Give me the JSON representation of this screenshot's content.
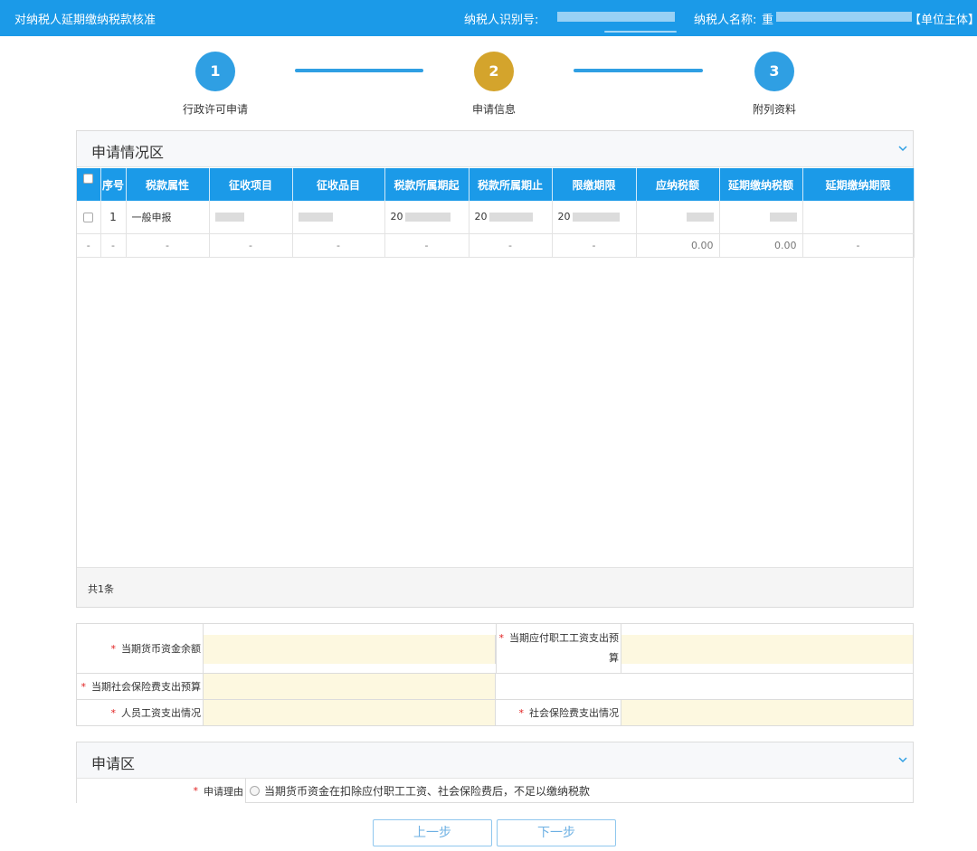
{
  "topbar": {
    "title": "对纳税人延期缴纳税款核准",
    "tin_label": "纳税人识别号:",
    "name_label": "纳税人名称:",
    "name_prefix": "重",
    "entity_tag": "【单位主体】"
  },
  "steps": [
    {
      "number": "1",
      "label": "行政许可申请"
    },
    {
      "number": "2",
      "label": "申请信息"
    },
    {
      "number": "3",
      "label": "附列资料"
    }
  ],
  "apply_status": {
    "title": "申请情况区",
    "columns": [
      "序号",
      "税款属性",
      "征收项目",
      "征收品目",
      "税款所属期起",
      "税款所属期止",
      "限缴期限",
      "应纳税额",
      "延期缴纳税额",
      "延期缴纳期限"
    ],
    "rows": [
      {
        "index": "1",
        "attr": "一般申报",
        "start_prefix": "20",
        "end_prefix": "20",
        "limit_prefix": "20"
      }
    ],
    "dash_row": {
      "dash": "-",
      "tax_amount": "0.00",
      "deferred_amount": "0.00"
    },
    "total": "共1条"
  },
  "form": {
    "cash_balance_label": "当期货币资金余额",
    "salary_budget_label_line1": "当期应付职工工资支出预",
    "salary_budget_label_line2": "算",
    "social_budget_label": "当期社会保险费支出预算",
    "salary_spend_label": "人员工资支出情况",
    "social_spend_label": "社会保险费支出情况",
    "required_mark": "*"
  },
  "apply_section": {
    "title": "申请区",
    "reason_label": "申请理由",
    "reason_option": "当期货币资金在扣除应付职工工资、社会保险费后，不足以缴纳税款"
  },
  "buttons": {
    "prev": "上一步",
    "next": "下一步"
  },
  "colors": {
    "brand_blue": "#1b9ae8",
    "step_active": "#d4a42c",
    "input_bg": "#fdf8e0",
    "required": "#e02020"
  }
}
